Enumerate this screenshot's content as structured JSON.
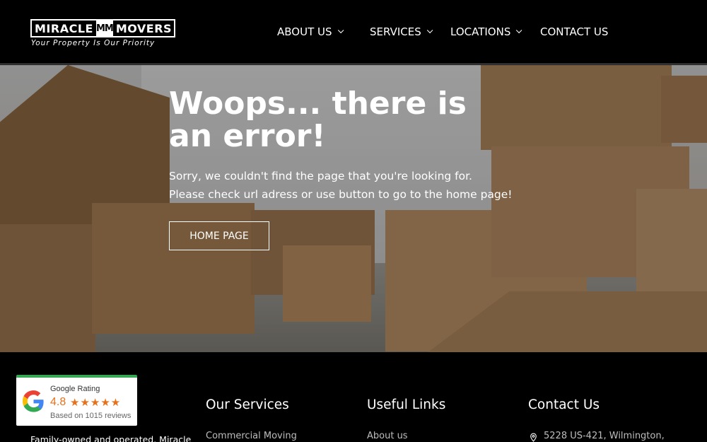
{
  "brand": {
    "left_word": "MIRACLE",
    "mark": "MM",
    "right_word": "MOVERS",
    "tagline": "Your Property Is Our Priority"
  },
  "nav": {
    "about": "ABOUT US",
    "services": "SERVICES",
    "locations": "LOCATIONS",
    "contact": "CONTACT US"
  },
  "hero": {
    "title": "Woops... there is an error!",
    "line1": "Sorry, we couldn't find the page that you're looking for.",
    "line2": "Please check url adress or use button to go to the home page!",
    "button": "HOME PAGE"
  },
  "footer": {
    "about_text": "Family-owned and operated. Miracle",
    "services_heading": "Our Services",
    "services_first": "Commercial Moving",
    "links_heading": "Useful Links",
    "links_first": "About us",
    "contact_heading": "Contact Us",
    "contact_address": "5228 US-421, Wilmington,"
  },
  "rating_badge": {
    "title": "Google Rating",
    "score": "4.8",
    "stars": "★★★★★",
    "reviews": "Based on 1015 reviews",
    "rating_value": 4.8,
    "rating_max": 5
  },
  "colors": {
    "background": "#000000",
    "star": "#e7711b",
    "badge_accent": "#34a853",
    "box": "#a8825a"
  }
}
